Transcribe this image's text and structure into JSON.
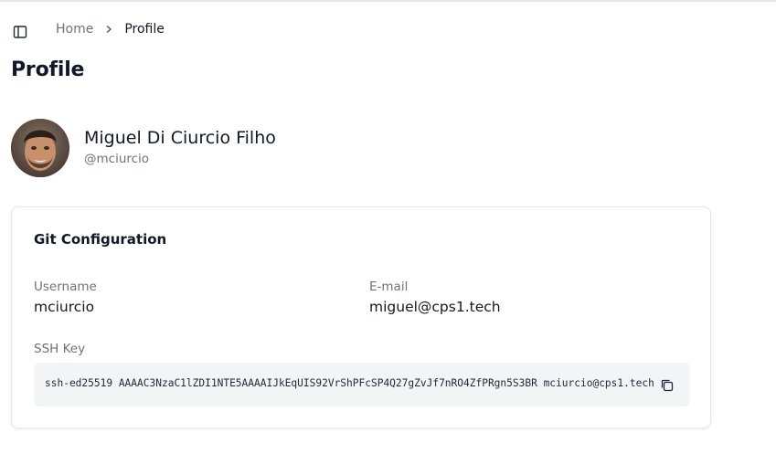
{
  "breadcrumb": {
    "home": "Home",
    "separator": "›",
    "current": "Profile"
  },
  "page": {
    "title": "Profile"
  },
  "user": {
    "name": "Miguel Di Ciurcio Filho",
    "handle": "@mciurcio"
  },
  "git_config": {
    "title": "Git Configuration",
    "username_label": "Username",
    "username_value": "mciurcio",
    "email_label": "E-mail",
    "email_value": "miguel@cps1.tech",
    "ssh_label": "SSH Key",
    "ssh_value": "ssh-ed25519 AAAAC3NzaC1lZDI1NTE5AAAAIJkEqUIS92VrShPFcSP4Q27gZvJf7nRO4ZfPRgn5S3BR mciurcio@cps1.tech"
  },
  "icons": {
    "sidebar_toggle": "panel-left-icon",
    "breadcrumb_separator": "chevron-right-icon",
    "copy": "copy-icon"
  }
}
